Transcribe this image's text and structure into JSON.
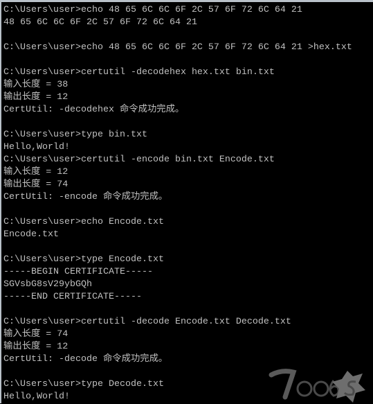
{
  "console": {
    "lines": [
      "C:\\Users\\user>echo 48 65 6C 6C 6F 2C 57 6F 72 6C 64 21",
      "48 65 6C 6C 6F 2C 57 6F 72 6C 64 21",
      "",
      "C:\\Users\\user>echo 48 65 6C 6C 6F 2C 57 6F 72 6C 64 21 >hex.txt",
      "",
      "C:\\Users\\user>certutil -decodehex hex.txt bin.txt",
      "输入长度 = 38",
      "输出长度 = 12",
      "CertUtil: -decodehex 命令成功完成。",
      "",
      "C:\\Users\\user>type bin.txt",
      "Hello,World!",
      "C:\\Users\\user>certutil -encode bin.txt Encode.txt",
      "输入长度 = 12",
      "输出长度 = 74",
      "CertUtil: -encode 命令成功完成。",
      "",
      "C:\\Users\\user>echo Encode.txt",
      "Encode.txt",
      "",
      "C:\\Users\\user>type Encode.txt",
      "-----BEGIN CERTIFICATE-----",
      "SGVsbG8sV29ybGQh",
      "-----END CERTIFICATE-----",
      "",
      "C:\\Users\\user>certutil -decode Encode.txt Decode.txt",
      "输入长度 = 74",
      "输出长度 = 12",
      "CertUtil: -decode 命令成功完成。",
      "",
      "C:\\Users\\user>type Decode.txt",
      "Hello,World!"
    ]
  },
  "watermark": {
    "text": "7oobs"
  },
  "colors": {
    "background": "#000000",
    "text": "#c0c0c0",
    "border": "#b9c1c9"
  }
}
